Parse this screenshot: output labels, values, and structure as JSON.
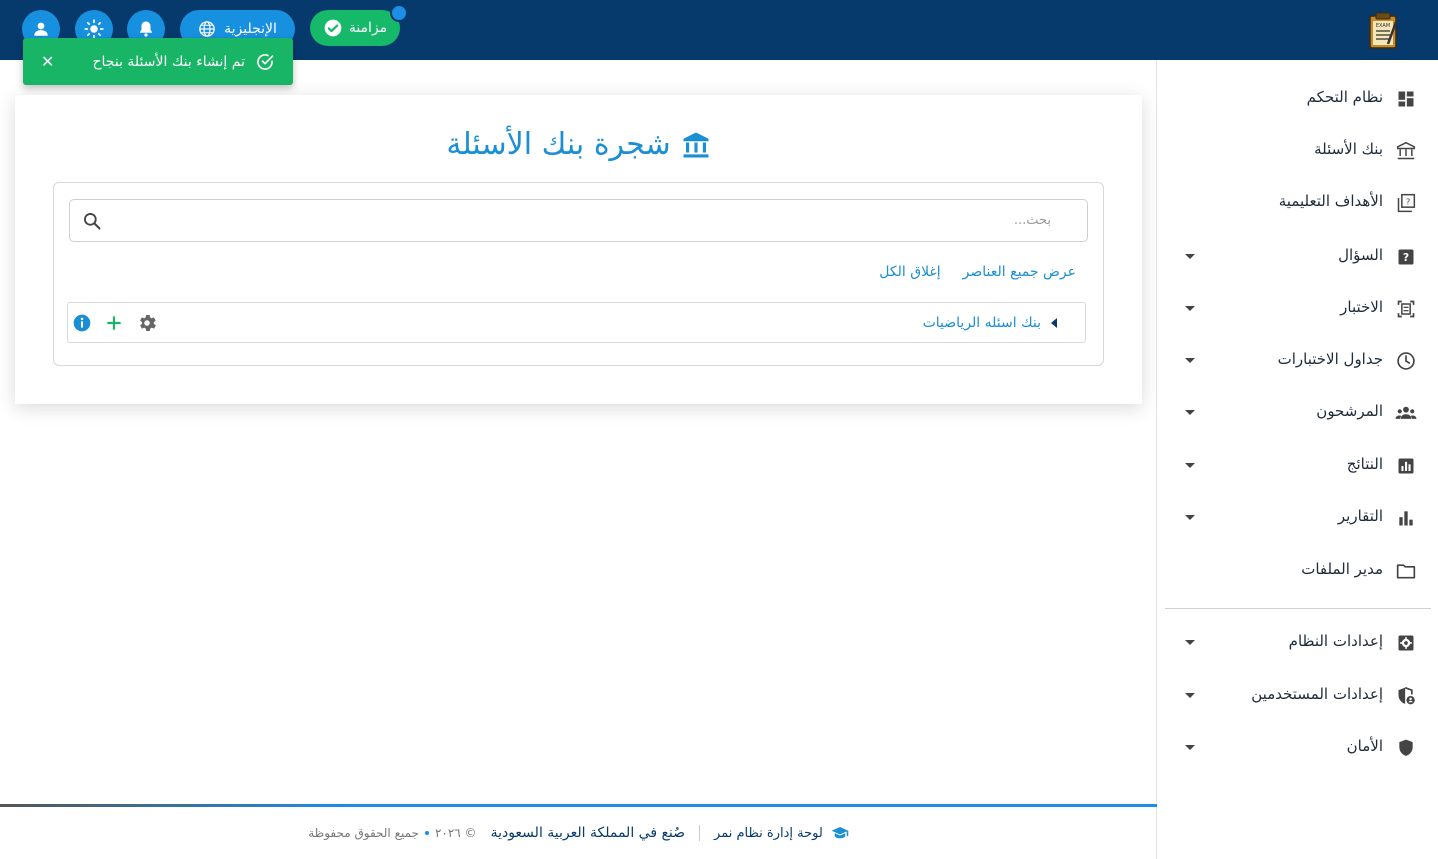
{
  "topbar": {
    "language_label": "الإنجليزية",
    "sync_label": "مزامنة"
  },
  "toast": {
    "message": "تم إنشاء بنك الأسئلة بنجاح",
    "close_symbol": "✕"
  },
  "card": {
    "title": "شجرة بنك الأسئلة",
    "search_placeholder": "بحث...",
    "show_all_label": "عرض جميع العناصر",
    "collapse_all_label": "إغلاق الكل",
    "tree": [
      {
        "label": "بنك اسئله الرياضيات"
      }
    ]
  },
  "sidebar": {
    "items": [
      {
        "label": "نظام التحكم",
        "icon": "dashboard-icon",
        "has_submenu": false
      },
      {
        "label": "بنك الأسئلة",
        "icon": "bank-icon",
        "has_submenu": false
      },
      {
        "label": "الأهداف التعليمية",
        "icon": "quiz-book-icon",
        "has_submenu": false
      },
      {
        "label": "السؤال",
        "icon": "question-icon",
        "has_submenu": true
      },
      {
        "label": "الاختبار",
        "icon": "exam-icon",
        "has_submenu": true
      },
      {
        "label": "جداول الاختبارات",
        "icon": "clock-icon",
        "has_submenu": true
      },
      {
        "label": "المرشحون",
        "icon": "people-icon",
        "has_submenu": true
      },
      {
        "label": "النتائج",
        "icon": "results-chart-icon",
        "has_submenu": true
      },
      {
        "label": "التقارير",
        "icon": "bar-chart-icon",
        "has_submenu": true
      },
      {
        "label": "مدير الملفات",
        "icon": "folder-icon",
        "has_submenu": false
      },
      {
        "label": "إعدادات النظام",
        "icon": "settings-icon",
        "has_submenu": true
      },
      {
        "label": "إعدادات المستخدمين",
        "icon": "user-shield-icon",
        "has_submenu": true
      },
      {
        "label": "الأمان",
        "icon": "shield-icon",
        "has_submenu": true
      }
    ]
  },
  "footer": {
    "brand": "لوحة إدارة نظام نمر",
    "made_in": "صُنع في المملكة العربية السعودية",
    "year": "© ٢٠٢٦",
    "rights": "جميع الحقوق محفوظة"
  },
  "colors": {
    "topbar": "#063a6d",
    "accent": "#1a8fd4",
    "success": "#19b566"
  }
}
